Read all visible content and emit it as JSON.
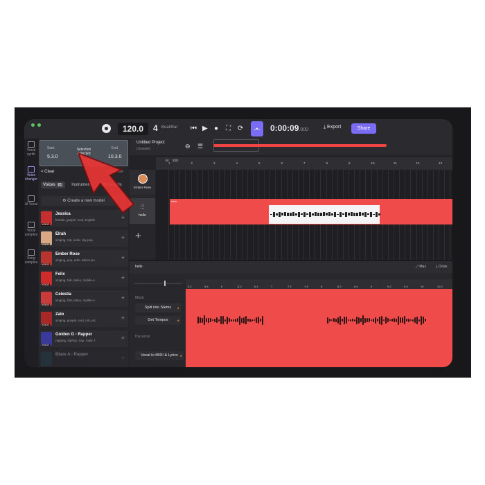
{
  "topbar": {
    "tempo": "120.0",
    "beats": "4",
    "beats_unit": "Beat/Bar",
    "time_main": "0:00:09",
    "time_ms": ".000",
    "export_label": "Export",
    "share_label": "Share"
  },
  "rail": {
    "items": [
      "Vocal synth",
      "Voice changer",
      "AI Vocal",
      "Vocal samples",
      "Song samples"
    ]
  },
  "selection": {
    "start_label": "Start",
    "start_value": "5.3.0",
    "center_label": "Selection detected",
    "end_label": "End",
    "end_value": "10.3.0"
  },
  "panel": {
    "clear_label": "< Clear",
    "in_selection": "in selection",
    "tabs": [
      {
        "label": "Voices",
        "badge": "81"
      },
      {
        "label": "Instruments"
      },
      {
        "label": "My models"
      }
    ],
    "create_label": "Create a new model"
  },
  "voices": [
    {
      "name": "Jessica",
      "desc": "female, gospel, soul, English",
      "tag": "VOICE",
      "color": "#c62f2f"
    },
    {
      "name": "Elrah",
      "desc": "singing, rnb, indie, city-pop,",
      "tag": "VOICE",
      "color": "#d9a987"
    },
    {
      "name": "Ember Rose",
      "desc": "singing, pop, edm, dance-po",
      "tag": "VOICE",
      "color": "#b8342e"
    },
    {
      "name": "Felix",
      "desc": "singing, folk, latino, middle-o",
      "tag": "VOICE",
      "color": "#d02b2b"
    },
    {
      "name": "Celestia",
      "desc": "singing, folk, latino, middle-o",
      "tag": "VOICE",
      "color": "#c93a3a"
    },
    {
      "name": "Zalo",
      "desc": "singing, gospel, soul, rnb, jaz",
      "tag": "VOICE",
      "color": "#a82727"
    },
    {
      "name": "Golden G - Rapper",
      "desc": "rapping, hiphop, trap, male, f",
      "tag": "VOICE",
      "color": "#3a3a9a"
    },
    {
      "name": "Blaze A - Rapper",
      "desc": "",
      "tag": "",
      "color": "#2a4a5a"
    }
  ],
  "project": {
    "title": "Untitled Project",
    "subtitle": "Unsaved",
    "marker_ai": "AI",
    "marker_bpm": "120",
    "bar_ticks": [
      "1",
      "2",
      "3",
      "4",
      "5",
      "6",
      "7",
      "8",
      "9",
      "10",
      "11",
      "12",
      "13"
    ]
  },
  "tracks": [
    {
      "name": "Ember Rose"
    },
    {
      "name": "hello"
    }
  ],
  "clip_label": "hello",
  "editor": {
    "track_name": "hello",
    "max_label": "Max",
    "close_label": "Close",
    "music_section": "Music",
    "split_label": "Split into Stems",
    "tempo_label": "Get Tempos",
    "dry_section": "Dry vocal",
    "midi_label": "Vocal to MIDI & Lyrics",
    "ruler_ticks": [
      "5.2",
      "5.4",
      "6",
      "6.2",
      "6.4",
      "7",
      "7.2",
      "7.4",
      "8",
      "8.2",
      "8.4",
      "9",
      "9.2",
      "9.4",
      "10",
      "10.2"
    ]
  }
}
